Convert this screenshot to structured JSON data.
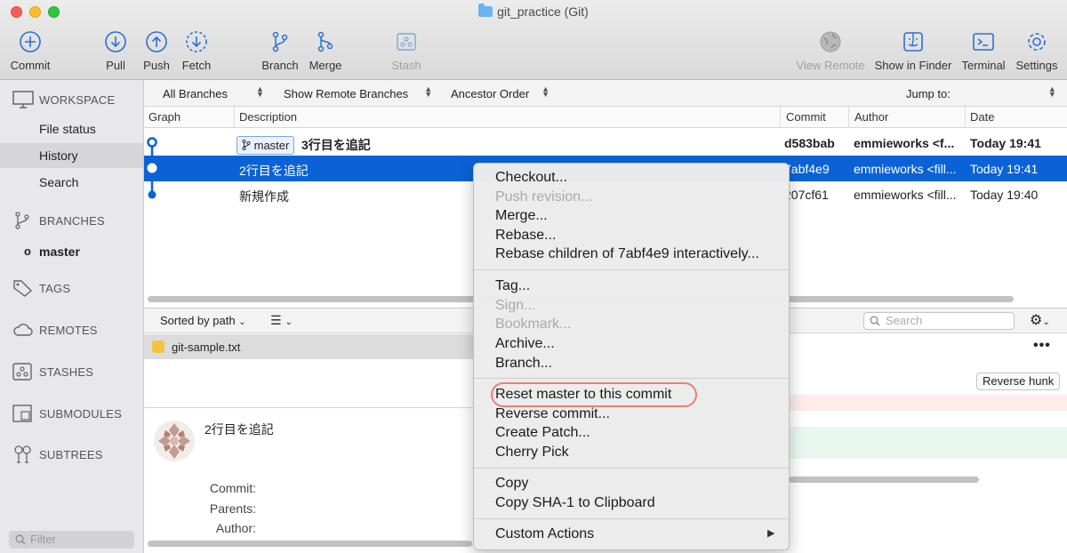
{
  "window": {
    "title": "git_practice (Git)"
  },
  "toolbar": {
    "commit": "Commit",
    "pull": "Pull",
    "push": "Push",
    "fetch": "Fetch",
    "branch": "Branch",
    "merge": "Merge",
    "stash": "Stash",
    "view_remote": "View Remote",
    "show_in_finder": "Show in Finder",
    "terminal": "Terminal",
    "settings": "Settings"
  },
  "sidebar": {
    "workspace": "WORKSPACE",
    "file_status": "File status",
    "history": "History",
    "search": "Search",
    "branches": "BRANCHES",
    "master": "master",
    "tags": "TAGS",
    "remotes": "REMOTES",
    "stashes": "STASHES",
    "submodules": "SUBMODULES",
    "subtrees": "SUBTREES",
    "filter_placeholder": "Filter"
  },
  "filterbar": {
    "branches": "All Branches",
    "remote": "Show Remote Branches",
    "order": "Ancestor Order",
    "jump": "Jump to:"
  },
  "columns": {
    "graph": "Graph",
    "description": "Description",
    "commit": "Commit",
    "author": "Author",
    "date": "Date"
  },
  "commits": [
    {
      "branch": "master",
      "description": "3行目を追記",
      "hash": "d583bab",
      "author": "emmieworks <f...",
      "date": "Today 19:41"
    },
    {
      "description": "2行目を追記",
      "hash": "7abf4e9",
      "author": "emmieworks <fill...",
      "date": "Today 19:41"
    },
    {
      "description": "新規作成",
      "hash": "207cf61",
      "author": "emmieworks <fill...",
      "date": "Today 19:40"
    }
  ],
  "lower": {
    "sort": "Sorted by path",
    "file": "git-sample.txt",
    "search_placeholder": "Search",
    "reverse_hunk": "Reverse hunk",
    "commit_title": "2行目を追記",
    "label_commit": "Commit:",
    "label_parents": "Parents:",
    "label_author": "Author:"
  },
  "context_menu": {
    "checkout": "Checkout...",
    "push_revision": "Push revision...",
    "merge": "Merge...",
    "rebase": "Rebase...",
    "rebase_children": "Rebase children of 7abf4e9 interactively...",
    "tag": "Tag...",
    "sign": "Sign...",
    "bookmark": "Bookmark...",
    "archive": "Archive...",
    "branch": "Branch...",
    "reset": "Reset master to this commit",
    "reverse": "Reverse commit...",
    "patch": "Create Patch...",
    "cherry": "Cherry Pick",
    "copy": "Copy",
    "copy_sha": "Copy SHA-1 to Clipboard",
    "custom": "Custom Actions"
  },
  "colors": {
    "selection": "#0b62d6",
    "highlight": "#e8816f"
  }
}
